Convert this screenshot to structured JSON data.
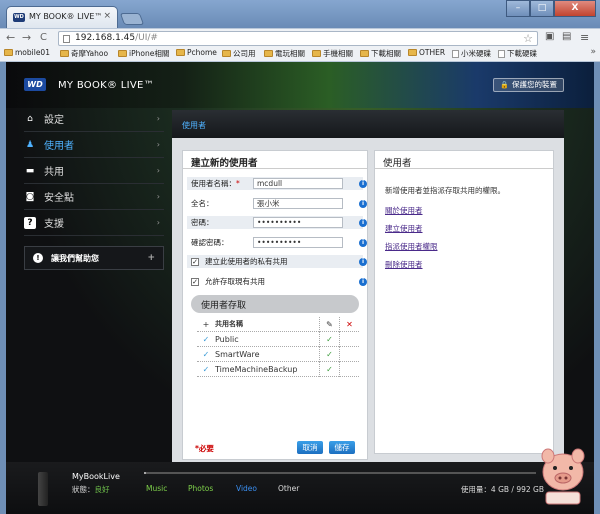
{
  "browser": {
    "tab_title": "MY BOOK® LIVE™",
    "tab_close": "×",
    "url_host": "192.168.1.45",
    "url_path": "/UI/#",
    "nav_back": "←",
    "nav_forward": "→",
    "nav_reload": "C",
    "win_min": "–",
    "win_max": "□",
    "win_close": "X",
    "bookmarks": [
      "mobile01",
      "奇摩Yahoo",
      "iPhone相關",
      "Pchome",
      "公司用",
      "電玩相關",
      "手機相關",
      "下載相關",
      "OTHER",
      "小米硬碟",
      "下載硬碟"
    ],
    "bookmarks_more": "»"
  },
  "header": {
    "logo": "WD",
    "brand": "MY BOOK® LIVE™",
    "protect_button": "保護您的裝置"
  },
  "sidebar": {
    "items": [
      {
        "label": "設定",
        "icon": "home-icon"
      },
      {
        "label": "使用者",
        "icon": "user-icon"
      },
      {
        "label": "共用",
        "icon": "folder-icon"
      },
      {
        "label": "安全點",
        "icon": "safepoint-icon"
      },
      {
        "label": "支援",
        "icon": "help-icon"
      }
    ],
    "chevron": "›",
    "help_box": "讓我們幫助您",
    "help_plus": "+"
  },
  "main": {
    "header": "使用者",
    "create_card": {
      "title": "建立新的使用者",
      "fields": [
        {
          "label": "使用者名稱：",
          "required": "*",
          "value": "mcdull"
        },
        {
          "label": "全名：",
          "required": "",
          "value": "張小米"
        },
        {
          "label": "密碼：",
          "required": "",
          "value": "••••••••••"
        },
        {
          "label": "確認密碼：",
          "required": "",
          "value": "••••••••••"
        }
      ],
      "checkboxes": [
        {
          "label": "建立此使用者的私有共用",
          "checked": "✓"
        },
        {
          "label": "允許存取現有共用",
          "checked": "✓"
        }
      ],
      "access_title": "使用者存取",
      "table_head": {
        "add": "+",
        "name": "共用名稱",
        "edit": "✎",
        "none": "✕"
      },
      "shares": [
        {
          "name": "Public",
          "mark": "✓",
          "edit": "✓"
        },
        {
          "name": "SmartWare",
          "mark": "✓",
          "edit": "✓"
        },
        {
          "name": "TimeMachineBackup",
          "mark": "✓",
          "edit": "✓"
        }
      ],
      "required_note": "*必要",
      "cancel_button": "取消",
      "save_button": "儲存"
    },
    "info_card": {
      "title": "使用者",
      "description": "新增使用者並指派存取共用的權限。",
      "links": [
        "關於使用者",
        "建立使用者",
        "指派使用者權限",
        "刪除使用者"
      ]
    },
    "info_icon": "i"
  },
  "status_bar": {
    "device_name": "MyBookLive",
    "status_label": "狀態：",
    "status_value": "良好",
    "legend": [
      {
        "label": "Music",
        "color": "#7ed04a"
      },
      {
        "label": "Photos",
        "color": "#7ed04a"
      },
      {
        "label": "Video",
        "color": "#3a8ef0"
      },
      {
        "label": "Other",
        "color": "#dddddd"
      }
    ],
    "usage_label": "使用量：",
    "usage_value": "4 GB / 992 GB",
    "usage_fraction": 0.004
  },
  "colors": {
    "accent": "#4fb2ff",
    "required": "#cc0000"
  }
}
